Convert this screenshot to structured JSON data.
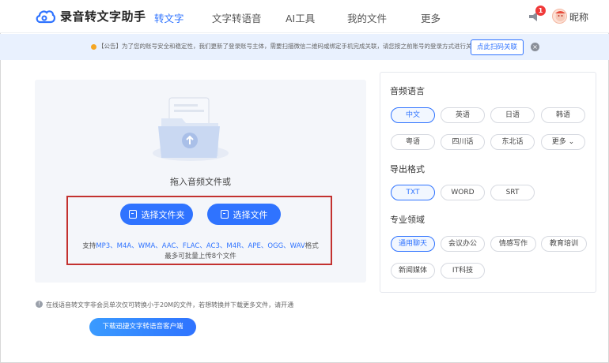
{
  "header": {
    "logo_text": "录音转文字助手",
    "nav": [
      "转文字",
      "文字转语音",
      "AI工具",
      "我的文件",
      "更多"
    ],
    "badge_count": "1",
    "nickname": "昵称"
  },
  "notice": {
    "text": "【公告】为了您的账号安全和稳定性，我们更新了登录账号主体，需要扫描微信二维码或绑定手机完成关联，请您按之前账号的登录方式进行关联。",
    "button": "点此扫码关联",
    "close": "×"
  },
  "upload": {
    "drop_text": "拖入音频文件或",
    "select_folder": "选择文件夹",
    "select_file": "选择文件",
    "support_prefix": "支持",
    "formats": "MP3、M4A、WMA、AAC、FLAC、AC3、M4R、APE、OGG、WAV",
    "support_suffix": "格式",
    "limit": "最多可批量上传8个文件"
  },
  "tip": {
    "icon": "!",
    "text": "在线语音转文字非会员单次仅可转换小于20M的文件，若想转换并下载更多文件，请开通"
  },
  "download_button": "下载迅捷文字转语音客户端",
  "right": {
    "language_title": "音频语言",
    "languages": [
      "中文",
      "英语",
      "日语",
      "韩语",
      "粤语",
      "四川话",
      "东北话",
      "更多"
    ],
    "format_title": "导出格式",
    "formats": [
      "TXT",
      "WORD",
      "SRT"
    ],
    "domain_title": "专业领域",
    "domains": [
      "通用聊天",
      "会议办公",
      "情感写作",
      "教育培训",
      "新闻媒体",
      "IT科技"
    ]
  },
  "colors": {
    "accent": "#2f73ff",
    "highlight_box": "#c3312f",
    "notice_bg": "#e9f1fe",
    "panel_bg": "#f4f6fa"
  }
}
